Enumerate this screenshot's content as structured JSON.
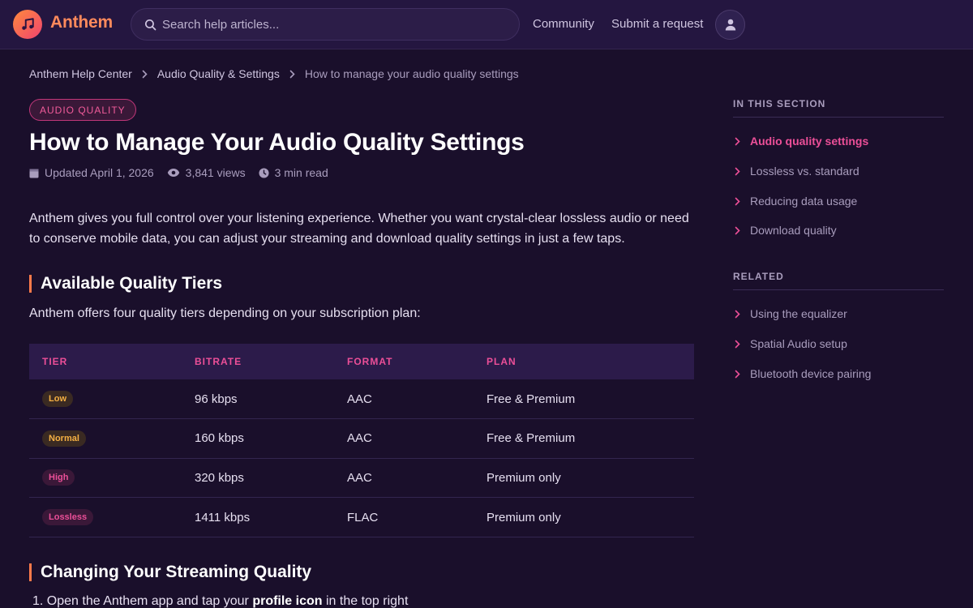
{
  "header": {
    "brand": "Anthem",
    "search_placeholder": "Search help articles...",
    "nav": [
      "Community",
      "Submit a request"
    ],
    "icons": [
      "music-note-icon",
      "search-icon",
      "user-icon"
    ],
    "accent_color": "#ff8a5c"
  },
  "breadcrumb": [
    "Anthem Help Center",
    "Audio Quality & Settings",
    "How to manage your audio quality settings"
  ],
  "article": {
    "tag": "AUDIO QUALITY",
    "title": "How to Manage Your Audio Quality Settings",
    "meta": {
      "updated": "Updated April 1, 2026",
      "views": "3,841 views",
      "read_time": "3 min read"
    },
    "intro": "Anthem gives you full control over your listening experience. Whether you want crystal-clear lossless audio or need to conserve mobile data, you can adjust your streaming and download quality settings in just a few taps.",
    "section1_title": "Available Quality Tiers",
    "section1_text": "Anthem offers four quality tiers depending on your subscription plan:",
    "table": {
      "headers": [
        "TIER",
        "BITRATE",
        "FORMAT",
        "PLAN"
      ],
      "rows": [
        {
          "tier": "Low",
          "bitrate": "96 kbps",
          "format": "AAC",
          "plan": "Free & Premium"
        },
        {
          "tier": "Normal",
          "bitrate": "160 kbps",
          "format": "AAC",
          "plan": "Free & Premium"
        },
        {
          "tier": "High",
          "bitrate": "320 kbps",
          "format": "AAC",
          "plan": "Premium only"
        },
        {
          "tier": "Lossless",
          "bitrate": "1411 kbps",
          "format": "FLAC",
          "plan": "Premium only"
        }
      ]
    },
    "section2_title": "Changing Your Streaming Quality",
    "step1": {
      "before": "Open the Anthem app and tap your ",
      "bold": "profile icon",
      "after": " in the top right"
    }
  },
  "sidebar": {
    "section_heading": "IN THIS SECTION",
    "section_items": [
      "Audio quality settings",
      "Lossless vs. standard",
      "Reducing data usage",
      "Download quality"
    ],
    "active_item": "Audio quality settings",
    "related_heading": "RELATED",
    "related_items": [
      "Using the equalizer",
      "Spatial Audio setup",
      "Bluetooth device pairing"
    ]
  }
}
